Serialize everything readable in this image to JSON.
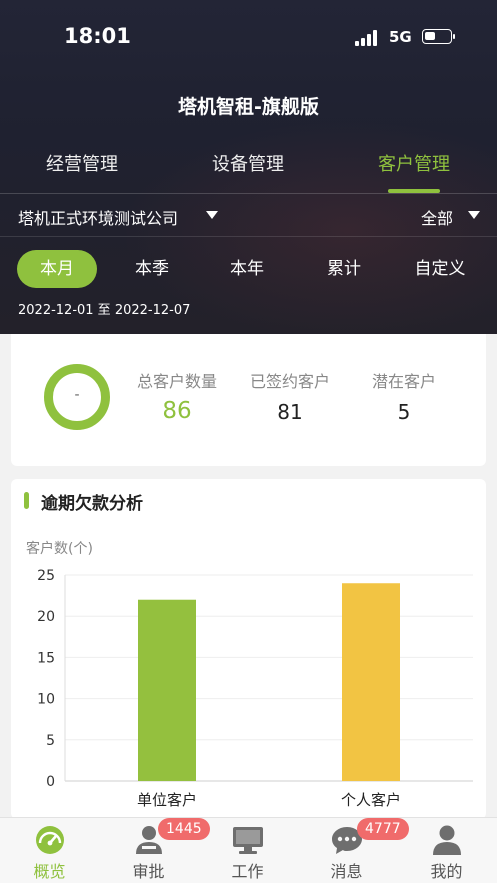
{
  "status_bar": {
    "time": "18:01",
    "network": "5G"
  },
  "app_title": "塔机智租-旗舰版",
  "tabs": [
    {
      "label": "经营管理",
      "active": false
    },
    {
      "label": "设备管理",
      "active": false
    },
    {
      "label": "客户管理",
      "active": true
    }
  ],
  "filters": {
    "company": "塔机正式环境测试公司",
    "scope": "全部"
  },
  "periods": [
    {
      "label": "本月",
      "active": true
    },
    {
      "label": "本季",
      "active": false
    },
    {
      "label": "本年",
      "active": false
    },
    {
      "label": "累计",
      "active": false
    },
    {
      "label": "自定义",
      "active": false
    }
  ],
  "date_range": "2022-12-01 至 2022-12-07",
  "summary": {
    "ring_label": "-",
    "total_label": "总客户数量",
    "total_value": "86",
    "signed_label": "已签约客户",
    "signed_value": "81",
    "potential_label": "潜在客户",
    "potential_value": "5"
  },
  "overdue_section": {
    "title": "逾期欠款分析"
  },
  "chart_data": {
    "type": "bar",
    "ylabel": "客户数(个)",
    "categories": [
      "单位客户",
      "个人客户"
    ],
    "values": [
      22,
      24
    ],
    "ylim": [
      0,
      25
    ],
    "yticks": [
      0,
      5,
      10,
      15,
      20,
      25
    ],
    "colors": [
      "#94c03e",
      "#f2c443"
    ],
    "grid": true
  },
  "tabbar": [
    {
      "label": "概览",
      "icon": "dashboard-gauge-icon",
      "active": true,
      "badge": ""
    },
    {
      "label": "审批",
      "icon": "approval-person-icon",
      "active": false,
      "badge": "1445"
    },
    {
      "label": "工作",
      "icon": "monitor-icon",
      "active": false,
      "badge": ""
    },
    {
      "label": "消息",
      "icon": "chat-bubble-icon",
      "active": false,
      "badge": "4777"
    },
    {
      "label": "我的",
      "icon": "user-profile-icon",
      "active": false,
      "badge": ""
    }
  ],
  "colors": {
    "accent": "#8fc13e",
    "badge": "#f06b6b",
    "header_bg": "#222433"
  }
}
